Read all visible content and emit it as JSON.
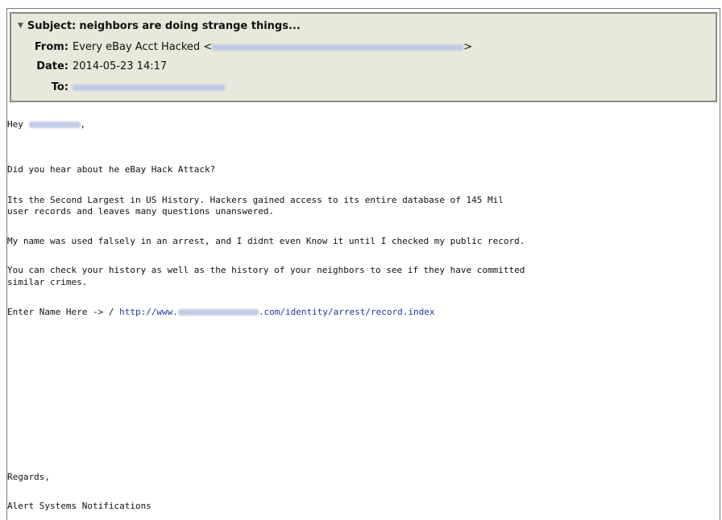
{
  "header": {
    "subject_label": "Subject:",
    "subject": "neighbors are doing strange things...",
    "from_label": "From:",
    "from_name": "Every eBay Acct Hacked <",
    "from_close": ">",
    "date_label": "Date:",
    "date": "2014-05-23 14:17",
    "to_label": "To:"
  },
  "body": {
    "greeting_prefix": "Hey",
    "greeting_suffix": ",",
    "para1": "Did you hear about he eBay Hack Attack?",
    "para2_line1": "Its the Second Largest in US History. Hackers gained access to its entire database of 145 Mil",
    "para2_line2": "user records and leaves many questions unanswered.",
    "para3": "My name was used falsely in an arrest, and I didnt even Know it until I checked my public record.",
    "para4_line1": "You can check your history as well as the history of your neighbors to see if they have committed",
    "para4_line2": "similar crimes.",
    "enter_prefix": "Enter Name Here -> / ",
    "link_start": "http://www.",
    "link_end": ".com/identity/arrest/record.index",
    "regards": "Regards,",
    "signature": "Alert Systems Notifications"
  }
}
